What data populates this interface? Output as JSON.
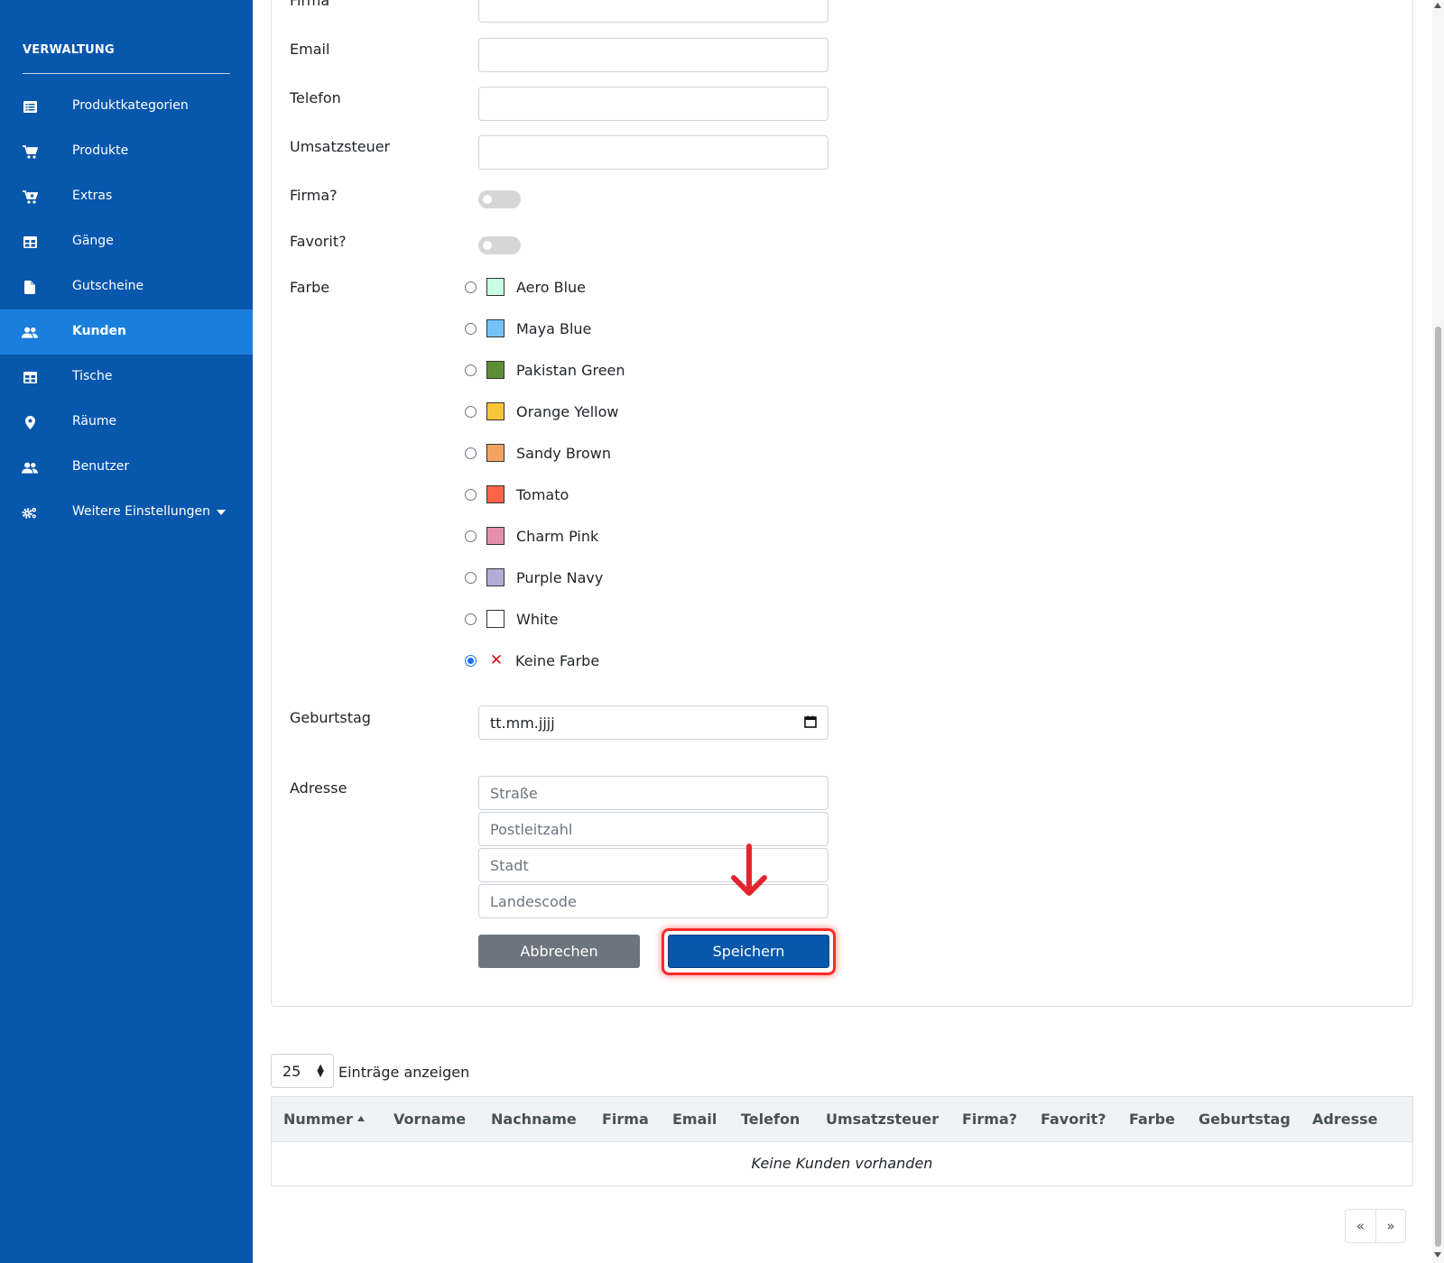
{
  "sidebar": {
    "section_title": "VERWALTUNG",
    "items": [
      {
        "label": "Produktkategorien",
        "icon": "list-icon",
        "active": false
      },
      {
        "label": "Produkte",
        "icon": "cart-icon",
        "active": false
      },
      {
        "label": "Extras",
        "icon": "cart-plus-icon",
        "active": false
      },
      {
        "label": "Gänge",
        "icon": "table-icon",
        "active": false
      },
      {
        "label": "Gutscheine",
        "icon": "file-icon",
        "active": false
      },
      {
        "label": "Kunden",
        "icon": "users-icon",
        "active": true
      },
      {
        "label": "Tische",
        "icon": "table-icon",
        "active": false
      },
      {
        "label": "Räume",
        "icon": "map-pin-icon",
        "active": false
      },
      {
        "label": "Benutzer",
        "icon": "users-icon",
        "active": false
      },
      {
        "label": "Weitere Einstellungen",
        "icon": "gears-icon",
        "active": false,
        "has_caret": true
      }
    ]
  },
  "form": {
    "firma_label": "Firma",
    "email_label": "Email",
    "telefon_label": "Telefon",
    "umsatzsteuer_label": "Umsatzsteuer",
    "firma_toggle_label": "Firma?",
    "favorit_toggle_label": "Favorit?",
    "farbe_label": "Farbe",
    "colors": [
      {
        "name": "Aero Blue",
        "hex": "#c9ffe5"
      },
      {
        "name": "Maya Blue",
        "hex": "#73c2fb"
      },
      {
        "name": "Pakistan Green",
        "hex": "#5f8f35"
      },
      {
        "name": "Orange Yellow",
        "hex": "#f8c43a"
      },
      {
        "name": "Sandy Brown",
        "hex": "#f4a460"
      },
      {
        "name": "Tomato",
        "hex": "#ff6347"
      },
      {
        "name": "Charm Pink",
        "hex": "#e68fac"
      },
      {
        "name": "Purple Navy",
        "hex": "#b1afd6"
      },
      {
        "name": "White",
        "hex": "#ffffff"
      }
    ],
    "no_color_label": "Keine Farbe",
    "selected_color": "Keine Farbe",
    "geburtstag_label": "Geburtstag",
    "geburtstag_placeholder": "tt.mm.jjjj",
    "adresse_label": "Adresse",
    "strasse_placeholder": "Straße",
    "plz_placeholder": "Postleitzahl",
    "stadt_placeholder": "Stadt",
    "landescode_placeholder": "Landescode",
    "cancel_label": "Abbrechen",
    "save_label": "Speichern"
  },
  "table": {
    "page_length": "25",
    "entries_label": "Einträge anzeigen",
    "columns": [
      "Nummer",
      "Vorname",
      "Nachname",
      "Firma",
      "Email",
      "Telefon",
      "Umsatzsteuer",
      "Firma?",
      "Favorit?",
      "Farbe",
      "Geburtstag",
      "Adresse"
    ],
    "empty_message": "Keine Kunden vorhanden",
    "prev_label": "«",
    "next_label": "»"
  },
  "colors": {
    "sidebar_bg": "#0757ad",
    "sidebar_active": "#1a7fdc",
    "primary": "#0757ad",
    "secondary": "#6c757d",
    "highlight": "#ff2a2a"
  }
}
